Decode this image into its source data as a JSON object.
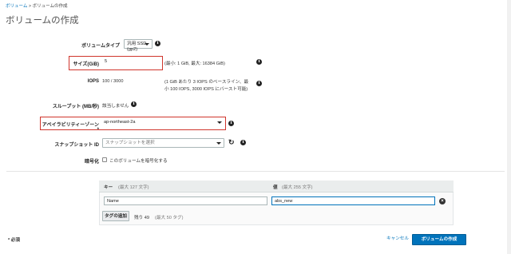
{
  "breadcrumb": {
    "link": "ボリューム",
    "separator": " > ",
    "current": "ボリュームの作成"
  },
  "page_title": "ボリュームの作成",
  "form": {
    "volume_type": {
      "label": "ボリュームタイプ",
      "value": "汎用 SSD (gp2)"
    },
    "size": {
      "label": "サイズ(GiB)",
      "value": "5",
      "hint": "(最小: 1 GiB, 最大: 16384 GiB)"
    },
    "iops": {
      "label": "IOPS",
      "value": "100 / 3000",
      "hint_line1": "(1 GiB あたり 3 IOPS のベースライン、最",
      "hint_line2": "小 100 IOPS, 3000 IOPS にバースト可能)"
    },
    "throughput": {
      "label": "スループット (MB/秒)",
      "value": "該当しません"
    },
    "az": {
      "label": "アベイラビリティーゾーン*",
      "value": "ap-northeast-2a"
    },
    "snapshot": {
      "label": "スナップショット ID",
      "placeholder": "スナップショットを選択"
    },
    "encryption": {
      "label": "暗号化",
      "checkbox_label": "このボリュームを暗号化する"
    }
  },
  "tags": {
    "key_header": "キー",
    "key_limit": "(最大 127 文字)",
    "value_header": "値",
    "value_limit": "(最大 255 文字)",
    "row": {
      "key": "Name",
      "value": "abs_new"
    },
    "add_button": "タグの追加",
    "remaining": "残り 49",
    "max_note": "(最大 50 タグ)"
  },
  "footer": {
    "required_note": "* 必須",
    "cancel": "キャンセル",
    "create": "ボリュームの作成"
  },
  "colors": {
    "accent": "#0073bb",
    "highlight": "#d0352c"
  }
}
